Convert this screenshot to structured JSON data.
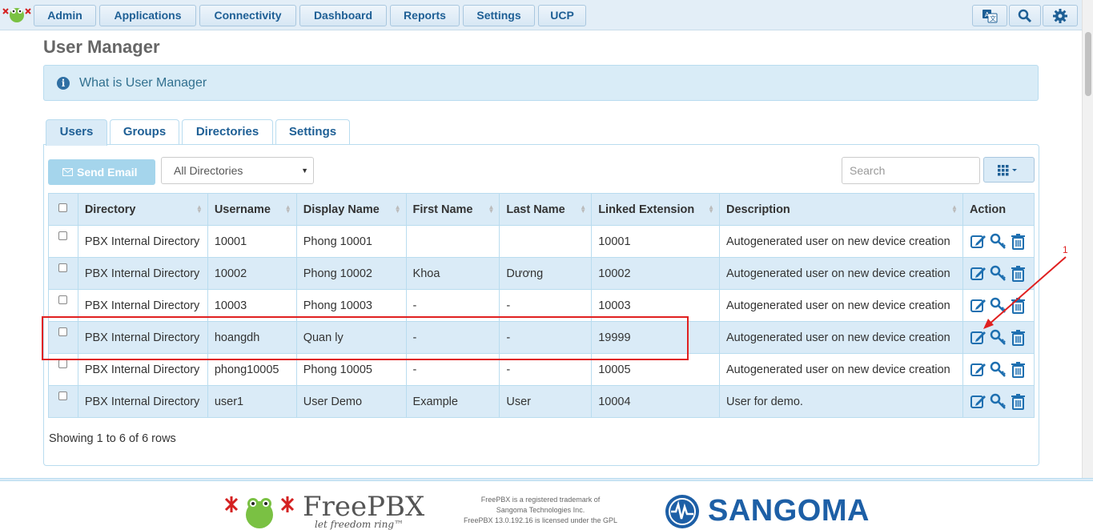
{
  "nav": {
    "items": [
      {
        "label": "Admin"
      },
      {
        "label": "Applications"
      },
      {
        "label": "Connectivity"
      },
      {
        "label": "Dashboard"
      },
      {
        "label": "Reports"
      },
      {
        "label": "Settings"
      },
      {
        "label": "UCP"
      }
    ],
    "icons": [
      "language-icon",
      "search-icon",
      "gear-icon"
    ]
  },
  "page": {
    "title": "User Manager",
    "info": "What is User Manager"
  },
  "tabs": [
    {
      "label": "Users",
      "active": true
    },
    {
      "label": "Groups"
    },
    {
      "label": "Directories"
    },
    {
      "label": "Settings"
    }
  ],
  "toolbar": {
    "send_email": "Send Email",
    "directory_select": "All Directories",
    "search_placeholder": "Search"
  },
  "table": {
    "headers": [
      "Directory",
      "Username",
      "Display Name",
      "First Name",
      "Last Name",
      "Linked Extension",
      "Description",
      "Action"
    ],
    "rows": [
      {
        "directory": "PBX Internal Directory",
        "username": "10001",
        "display_name": "Phong 10001",
        "first_name": "",
        "last_name": "",
        "extension": "10001",
        "description": "Autogenerated user on new device creation"
      },
      {
        "directory": "PBX Internal Directory",
        "username": "10002",
        "display_name": "Phong 10002",
        "first_name": "Khoa",
        "last_name": "Dương",
        "extension": "10002",
        "description": "Autogenerated user on new device creation"
      },
      {
        "directory": "PBX Internal Directory",
        "username": "10003",
        "display_name": "Phong 10003",
        "first_name": "-",
        "last_name": "-",
        "extension": "10003",
        "description": "Autogenerated user on new device creation"
      },
      {
        "directory": "PBX Internal Directory",
        "username": "hoangdh",
        "display_name": "Quan ly",
        "first_name": "-",
        "last_name": "-",
        "extension": "19999",
        "description": "Autogenerated user on new device creation"
      },
      {
        "directory": "PBX Internal Directory",
        "username": "phong10005",
        "display_name": "Phong 10005",
        "first_name": "-",
        "last_name": "-",
        "extension": "10005",
        "description": "Autogenerated user on new device creation"
      },
      {
        "directory": "PBX Internal Directory",
        "username": "user1",
        "display_name": "User Demo",
        "first_name": "Example",
        "last_name": "User",
        "extension": "10004",
        "description": "User for demo."
      }
    ]
  },
  "status": "Showing 1 to 6 of 6 rows",
  "annotation": "1",
  "footer": {
    "freepbx": "FreePBX",
    "freepbx_tagline": "let freedom ring™",
    "legal_1": "FreePBX is a registered trademark of",
    "legal_2": "Sangoma Technologies Inc.",
    "legal_3": "FreePBX 13.0.192.16 is licensed under the GPL",
    "sangoma": "SANGOMA"
  },
  "colors": {
    "accent": "#1e5f95",
    "row_alt": "#daebf7",
    "highlight": "#e02020"
  }
}
